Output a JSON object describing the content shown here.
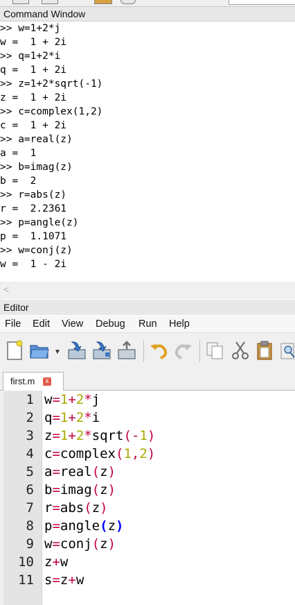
{
  "command_window": {
    "title": "Command Window",
    "lines": [
      ">> w=1+2*j",
      "w =  1 + 2i",
      ">> q=1+2*i",
      "q =  1 + 2i",
      ">> z=1+2*sqrt(-1)",
      "z =  1 + 2i",
      ">> c=complex(1,2)",
      "c =  1 + 2i",
      ">> a=real(z)",
      "a =  1",
      ">> b=imag(z)",
      "b =  2",
      ">> r=abs(z)",
      "r =  2.2361",
      ">> p=angle(z)",
      "p =  1.1071",
      ">> w=conj(z)",
      "w =  1 - 2i"
    ]
  },
  "scrollbar": {
    "left_arrow": "<"
  },
  "editor": {
    "title": "Editor",
    "menu": [
      "File",
      "Edit",
      "View",
      "Debug",
      "Run",
      "Help"
    ],
    "tab": {
      "label": "first.m",
      "close": "x"
    },
    "toolbar_icons": [
      "new-file-icon",
      "open-folder-icon",
      "dropdown-arrow-icon",
      "save-icon",
      "save-as-icon",
      "save-all-icon",
      "undo-icon",
      "redo-icon",
      "copy-icon",
      "cut-icon",
      "paste-icon",
      "find-icon"
    ],
    "line_numbers": [
      "1",
      "2",
      "3",
      "4",
      "5",
      "6",
      "7",
      "8",
      "9",
      "10",
      "11"
    ],
    "code": [
      [
        {
          "t": "w",
          "c": "plain"
        },
        {
          "t": "=",
          "c": "op"
        },
        {
          "t": "1",
          "c": "num"
        },
        {
          "t": "+",
          "c": "op"
        },
        {
          "t": "2",
          "c": "num"
        },
        {
          "t": "*",
          "c": "op"
        },
        {
          "t": "j",
          "c": "plain"
        }
      ],
      [
        {
          "t": "q",
          "c": "plain"
        },
        {
          "t": "=",
          "c": "op"
        },
        {
          "t": "1",
          "c": "num"
        },
        {
          "t": "+",
          "c": "op"
        },
        {
          "t": "2",
          "c": "num"
        },
        {
          "t": "*",
          "c": "op"
        },
        {
          "t": "i",
          "c": "plain"
        }
      ],
      [
        {
          "t": "z",
          "c": "plain"
        },
        {
          "t": "=",
          "c": "op"
        },
        {
          "t": "1",
          "c": "num"
        },
        {
          "t": "+",
          "c": "op"
        },
        {
          "t": "2",
          "c": "num"
        },
        {
          "t": "*",
          "c": "op"
        },
        {
          "t": "sqrt",
          "c": "plain"
        },
        {
          "t": "(",
          "c": "paren"
        },
        {
          "t": "-",
          "c": "op"
        },
        {
          "t": "1",
          "c": "num"
        },
        {
          "t": ")",
          "c": "paren"
        }
      ],
      [
        {
          "t": "c",
          "c": "plain"
        },
        {
          "t": "=",
          "c": "op"
        },
        {
          "t": "complex",
          "c": "plain"
        },
        {
          "t": "(",
          "c": "paren"
        },
        {
          "t": "1",
          "c": "num"
        },
        {
          "t": ",",
          "c": "op"
        },
        {
          "t": "2",
          "c": "num"
        },
        {
          "t": ")",
          "c": "paren"
        }
      ],
      [
        {
          "t": "a",
          "c": "plain"
        },
        {
          "t": "=",
          "c": "op"
        },
        {
          "t": "real",
          "c": "plain"
        },
        {
          "t": "(",
          "c": "paren"
        },
        {
          "t": "z",
          "c": "plain"
        },
        {
          "t": ")",
          "c": "paren"
        }
      ],
      [
        {
          "t": "b",
          "c": "plain"
        },
        {
          "t": "=",
          "c": "op"
        },
        {
          "t": "imag",
          "c": "plain"
        },
        {
          "t": "(",
          "c": "paren"
        },
        {
          "t": "z",
          "c": "plain"
        },
        {
          "t": ")",
          "c": "paren"
        }
      ],
      [
        {
          "t": "r",
          "c": "plain"
        },
        {
          "t": "=",
          "c": "op"
        },
        {
          "t": "abs",
          "c": "plain"
        },
        {
          "t": "(",
          "c": "paren"
        },
        {
          "t": "z",
          "c": "plain"
        },
        {
          "t": ")",
          "c": "paren"
        }
      ],
      [
        {
          "t": "p",
          "c": "plain"
        },
        {
          "t": "=",
          "c": "op"
        },
        {
          "t": "angle",
          "c": "plain"
        },
        {
          "t": "(",
          "c": "bparen"
        },
        {
          "t": "z",
          "c": "plain"
        },
        {
          "t": ")",
          "c": "bparen"
        }
      ],
      [
        {
          "t": "w",
          "c": "plain"
        },
        {
          "t": "=",
          "c": "op"
        },
        {
          "t": "conj",
          "c": "plain"
        },
        {
          "t": "(",
          "c": "paren"
        },
        {
          "t": "z",
          "c": "plain"
        },
        {
          "t": ")",
          "c": "paren"
        }
      ],
      [
        {
          "t": "z",
          "c": "plain"
        },
        {
          "t": "+",
          "c": "op"
        },
        {
          "t": "w",
          "c": "plain"
        }
      ],
      [
        {
          "t": "s",
          "c": "plain"
        },
        {
          "t": "=",
          "c": "op"
        },
        {
          "t": "z",
          "c": "plain"
        },
        {
          "t": "+",
          "c": "op"
        },
        {
          "t": "w",
          "c": "plain"
        }
      ]
    ]
  },
  "colors": {
    "number": "#a9a900",
    "operator": "#c0003c",
    "matched_paren": "#0000ff",
    "gutter": "#e4e4e4",
    "panel": "#e8e8e8"
  }
}
